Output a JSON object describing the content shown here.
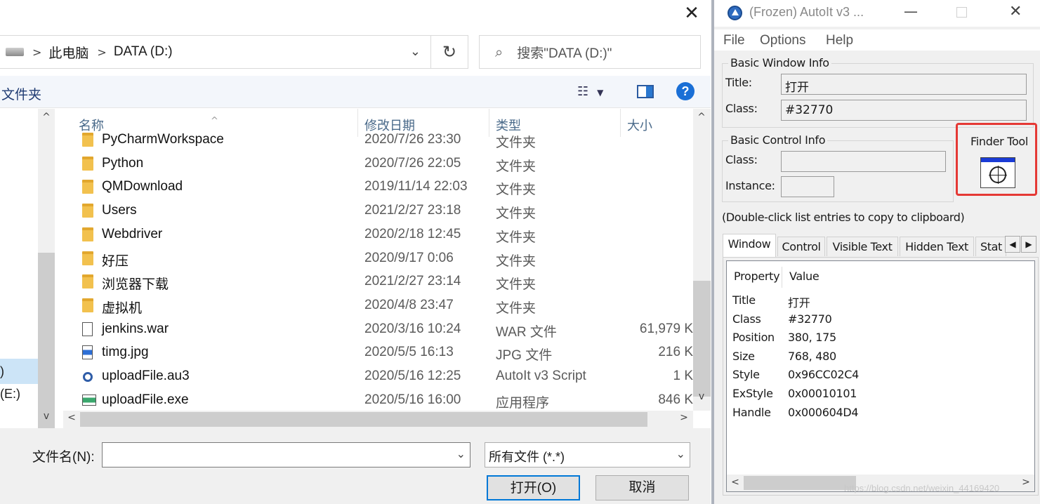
{
  "dialog": {
    "close_glyph": "✕",
    "address": {
      "separator": ">",
      "crumbs": [
        "此电脑",
        "DATA (D:)"
      ],
      "dropdown_glyph": "⌄",
      "refresh_glyph": "↻"
    },
    "search_placeholder": "搜索\"DATA (D:)\"",
    "search_icon": "search-icon",
    "toolbar": {
      "new_folder_label": "文件夹",
      "view_menu_glyph": "☷",
      "view_menu_arrow": "▼",
      "help_label": "?"
    },
    "nav_pane": {
      "selected_item_partial": ")",
      "item_partial": "(E:)"
    },
    "columns": [
      "名称",
      "修改日期",
      "类型",
      "大小"
    ],
    "sort_indicator": "^",
    "files": [
      {
        "icon": "folder",
        "name": "PyCharmWorkspace",
        "date": "2020/7/26 23:30",
        "type": "文件夹",
        "size": ""
      },
      {
        "icon": "folder",
        "name": "Python",
        "date": "2020/7/26 22:05",
        "type": "文件夹",
        "size": ""
      },
      {
        "icon": "folder",
        "name": "QMDownload",
        "date": "2019/11/14 22:03",
        "type": "文件夹",
        "size": ""
      },
      {
        "icon": "folder",
        "name": "Users",
        "date": "2021/2/27 23:18",
        "type": "文件夹",
        "size": ""
      },
      {
        "icon": "folder",
        "name": "Webdriver",
        "date": "2020/2/18 12:45",
        "type": "文件夹",
        "size": ""
      },
      {
        "icon": "folder",
        "name": "好压",
        "date": "2020/9/17 0:06",
        "type": "文件夹",
        "size": ""
      },
      {
        "icon": "folder",
        "name": "浏览器下载",
        "date": "2021/2/27 23:14",
        "type": "文件夹",
        "size": ""
      },
      {
        "icon": "folder",
        "name": "虚拟机",
        "date": "2020/4/8 23:47",
        "type": "文件夹",
        "size": ""
      },
      {
        "icon": "doc",
        "name": "jenkins.war",
        "date": "2020/3/16 10:24",
        "type": "WAR 文件",
        "size": "61,979 K"
      },
      {
        "icon": "img",
        "name": "timg.jpg",
        "date": "2020/5/5 16:13",
        "type": "JPG 文件",
        "size": "216 K"
      },
      {
        "icon": "au3",
        "name": "uploadFile.au3",
        "date": "2020/5/16 12:25",
        "type": "AutoIt v3 Script",
        "size": "1 K"
      },
      {
        "icon": "exe",
        "name": "uploadFile.exe",
        "date": "2020/5/16 16:00",
        "type": "应用程序",
        "size": "846 K"
      }
    ],
    "scroll_glyphs": {
      "up": "^",
      "down": "v",
      "left": "<",
      "right": ">"
    },
    "filename_label": "文件名(N):",
    "filename_value": "",
    "filter_value": "所有文件 (*.*)",
    "open_button": "打开(O)",
    "cancel_button": "取消"
  },
  "autoit": {
    "title": "(Frozen) AutoIt v3 ...",
    "window_controls": {
      "minimize": "—",
      "close": "✕"
    },
    "menu": [
      "File",
      "Options",
      "Help"
    ],
    "basic_window_info": {
      "label": "Basic Window Info",
      "title_label": "Title:",
      "title_value": "打开",
      "class_label": "Class:",
      "class_value": "#32770"
    },
    "basic_control_info": {
      "label": "Basic Control Info",
      "class_label": "Class:",
      "class_value": "",
      "instance_label": "Instance:",
      "instance_value": ""
    },
    "finder_tool_label": "Finder Tool",
    "hint": "(Double-click list entries to copy to clipboard)",
    "tabs": [
      "Window",
      "Control",
      "Visible Text",
      "Hidden Text",
      "Stat"
    ],
    "tab_scroll": {
      "left": "◀",
      "right": "▶"
    },
    "list_headers": [
      "Property",
      "Value"
    ],
    "properties": [
      {
        "key": "Title",
        "value": "打开"
      },
      {
        "key": "Class",
        "value": "#32770"
      },
      {
        "key": "Position",
        "value": "380, 175"
      },
      {
        "key": "Size",
        "value": "768, 480"
      },
      {
        "key": "Style",
        "value": "0x96CC02C4"
      },
      {
        "key": "ExStyle",
        "value": "0x00010101"
      },
      {
        "key": "Handle",
        "value": "0x000604D4"
      }
    ],
    "list_scroll": {
      "left": "<",
      "right": ">"
    },
    "watermark": "https://blog.csdn.net/weixin_44169420"
  }
}
